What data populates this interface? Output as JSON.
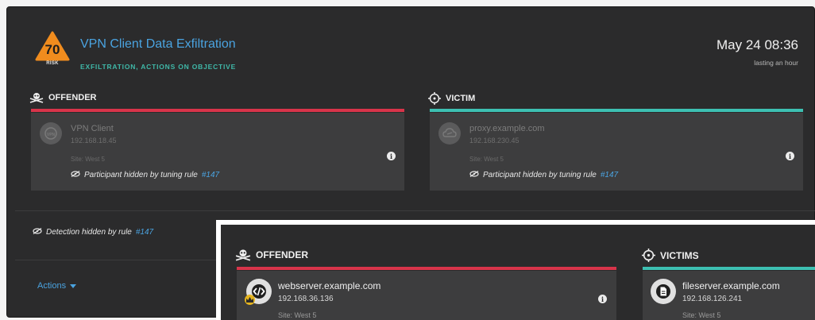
{
  "detection": {
    "risk_score": "70",
    "risk_label": "RISK",
    "title": "VPN Client Data Exfiltration",
    "categories": "EXFILTRATION, ACTIONS ON OBJECTIVE",
    "date": "May 24 08:36",
    "duration": "lasting an hour",
    "hidden_text": "Detection hidden by rule",
    "hidden_rule": "#147"
  },
  "offender": {
    "heading": "OFFENDER",
    "name": "VPN Client",
    "ip": "192.168.18.45",
    "site": "Site: West 5",
    "hidden_text": "Participant hidden by tuning rule",
    "hidden_rule": "#147"
  },
  "victim": {
    "heading": "VICTIM",
    "name": "proxy.example.com",
    "ip": "192.168.230.45",
    "site": "Site: West 5",
    "hidden_text": "Participant hidden by tuning rule",
    "hidden_rule": "#147"
  },
  "actions": {
    "label": "Actions"
  },
  "overlay": {
    "offender": {
      "heading": "OFFENDER",
      "name": "webserver.example.com",
      "ip": "192.168.36.136",
      "site": "Site: West 5"
    },
    "victims": {
      "heading": "VICTIMS",
      "name": "fileserver.example.com",
      "ip": "192.168.126.241",
      "site": "Site: West 5"
    }
  },
  "colors": {
    "risk_orange": "#f08c1e",
    "link_blue": "#4aa3e0",
    "category_teal": "#3fb8a8",
    "offender_red": "#d8344a",
    "victim_teal": "#3dc0b2"
  },
  "icons": {
    "risk": "risk-triangle-icon",
    "offender": "skull-crossbones-icon",
    "victim": "crosshair-icon",
    "hidden": "eye-slash-icon",
    "info": "info-icon",
    "vpn": "vpn-icon",
    "proxy": "cloud-link-icon",
    "webserver": "code-icon",
    "fileserver": "file-icon",
    "crown": "crown-icon"
  }
}
